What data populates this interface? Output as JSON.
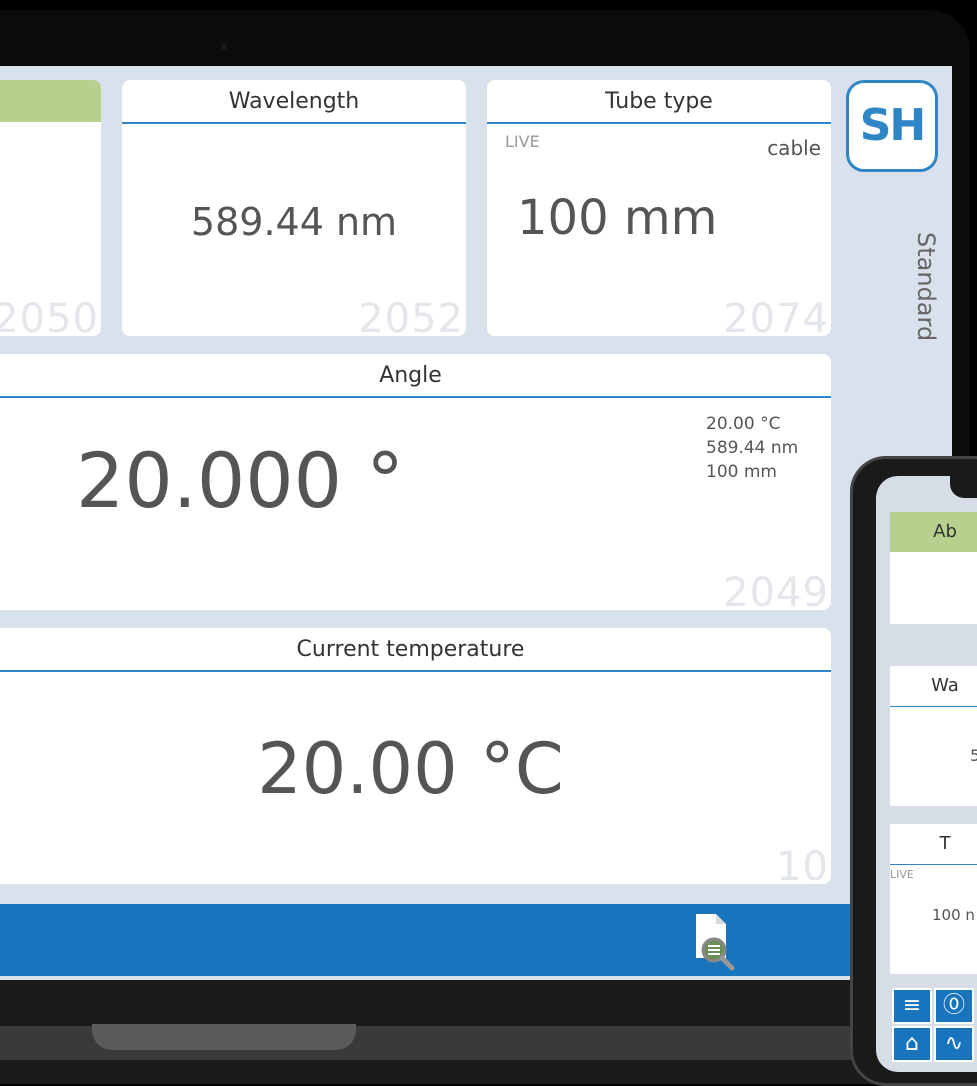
{
  "laptop": {
    "panels": {
      "first": {
        "code": "2050"
      },
      "wavelength": {
        "title": "Wavelength",
        "value": "589.44 nm",
        "code": "2052"
      },
      "tube": {
        "title": "Tube type",
        "live": "LIVE",
        "mode": "cable",
        "value": "100 mm",
        "code": "2074"
      },
      "angle": {
        "title": "Angle",
        "value": "20.000 °",
        "info": [
          "20.00 °C",
          "589.44 nm",
          "100 mm"
        ],
        "code": "2049"
      },
      "temperature": {
        "title": "Current temperature",
        "value": "20.00 °C",
        "code": "10"
      }
    },
    "logo": "SH",
    "mode_label": "Standard",
    "footer": {
      "icon": "document-search-icon"
    }
  },
  "phone": {
    "cards": [
      {
        "title": "Ab",
        "value": ""
      },
      {
        "title": "Wa",
        "value": "5"
      },
      {
        "title": "T",
        "live": "LIVE",
        "value": "100 n"
      }
    ],
    "buttons": [
      {
        "icon": "menu-icon",
        "glyph": "≡"
      },
      {
        "icon": "zero-icon",
        "glyph": "⓪"
      },
      {
        "icon": "home-icon",
        "glyph": "⌂"
      },
      {
        "icon": "waveform-icon",
        "glyph": "∿"
      }
    ]
  },
  "colors": {
    "accent": "#1774bd",
    "header_green": "#b8d08d",
    "background": "#d9e2ec"
  }
}
